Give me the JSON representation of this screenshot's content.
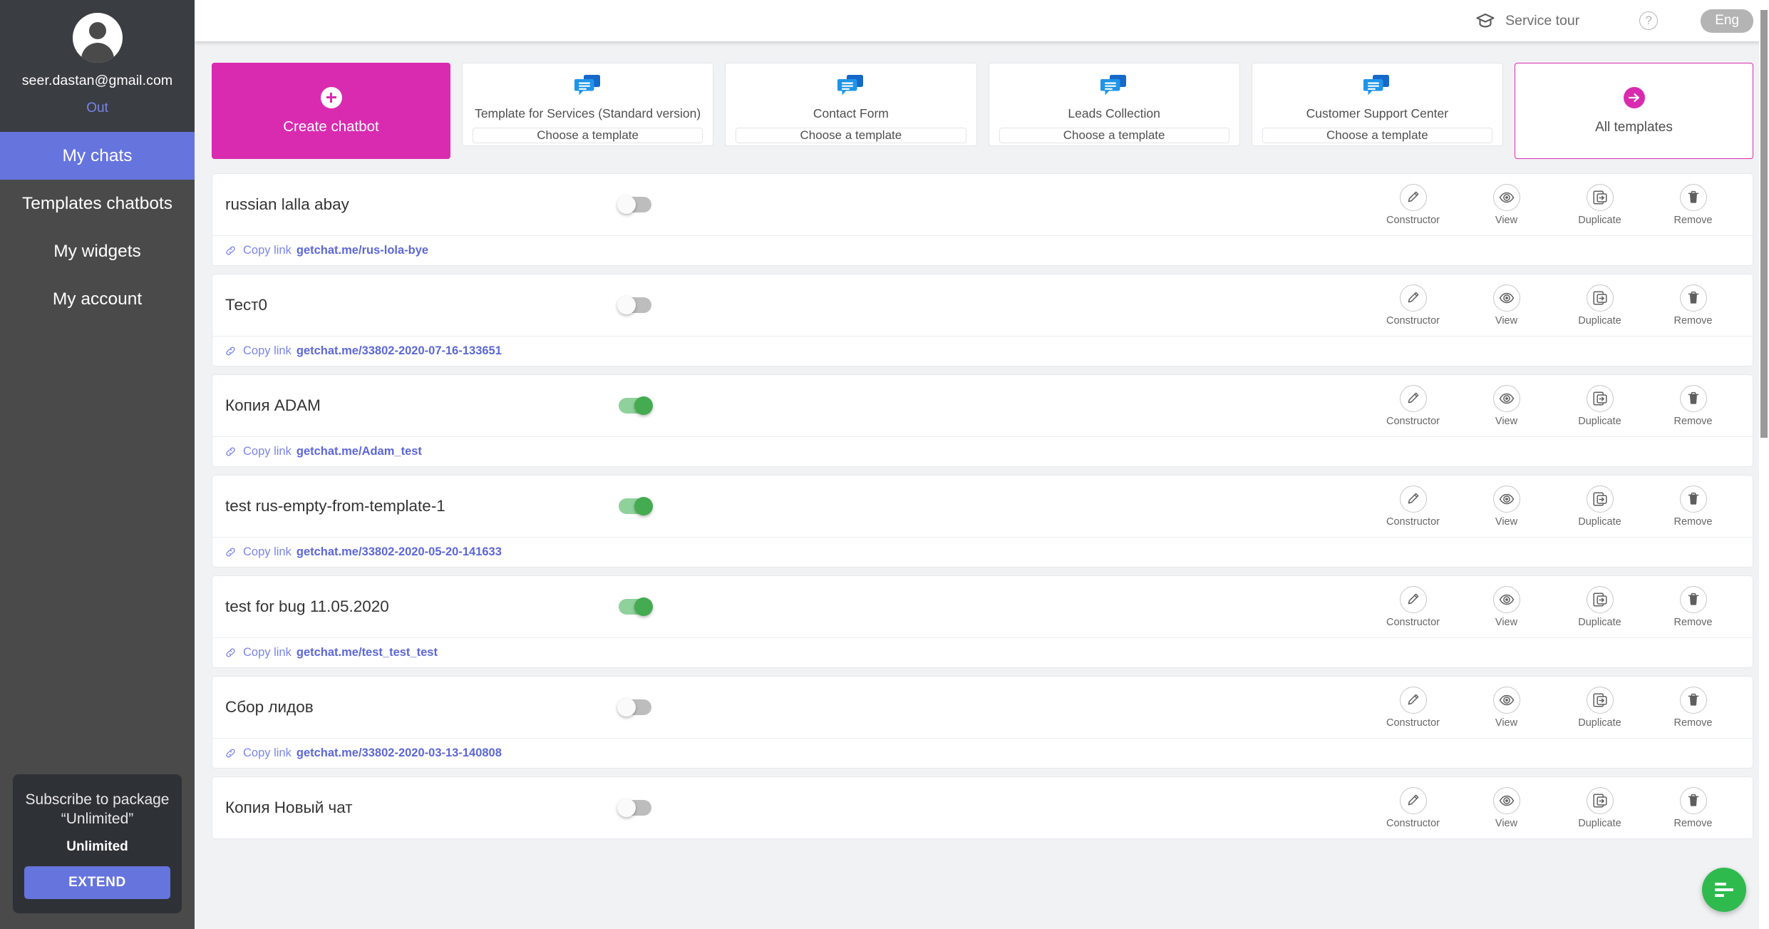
{
  "sidebar": {
    "avatar_icon": "user-avatar-icon",
    "email": "seer.dastan@gmail.com",
    "logout_label": "Out",
    "nav": [
      {
        "label": "My chats",
        "active": true
      },
      {
        "label": "Templates chatbots",
        "active": false
      },
      {
        "label": "My widgets",
        "active": false
      },
      {
        "label": "My account",
        "active": false
      }
    ],
    "subscribe": {
      "title": "Subscribe to package “Unlimited”",
      "plan": "Unlimited",
      "button_label": "EXTEND"
    }
  },
  "header": {
    "service_tour_label": "Service tour",
    "service_tour_icon": "graduation-cap-icon",
    "help_icon": "question-mark-icon",
    "help_glyph": "?",
    "language_label": "Eng"
  },
  "templates": {
    "create": {
      "label": "Create chatbot",
      "icon": "plus-circle-icon"
    },
    "cards": [
      {
        "name": "Template for Services (Standard version)",
        "button_label": "Choose a template",
        "icon": "chat-bubbles-icon"
      },
      {
        "name": "Contact Form",
        "button_label": "Choose a template",
        "icon": "chat-bubbles-icon"
      },
      {
        "name": "Leads Collection",
        "button_label": "Choose a template",
        "icon": "chat-bubbles-icon"
      },
      {
        "name": "Customer Support Center",
        "button_label": "Choose a template",
        "icon": "chat-bubbles-icon"
      }
    ],
    "all": {
      "label": "All templates",
      "icon": "arrow-right-circle-icon"
    }
  },
  "actions": {
    "constructor": {
      "label": "Constructor",
      "icon": "pencil-icon"
    },
    "view": {
      "label": "View",
      "icon": "eye-icon"
    },
    "duplicate": {
      "label": "Duplicate",
      "icon": "duplicate-icon"
    },
    "remove": {
      "label": "Remove",
      "icon": "trash-icon"
    }
  },
  "copy_link_label": "Copy link",
  "link_icon": "chain-link-icon",
  "chatbots": [
    {
      "name": "russian lalla abay",
      "enabled": false,
      "url": "getchat.me/rus-lola-bye"
    },
    {
      "name": "Тест0",
      "enabled": false,
      "url": "getchat.me/33802-2020-07-16-133651"
    },
    {
      "name": "Копия ADAM",
      "enabled": true,
      "url": "getchat.me/Adam_test"
    },
    {
      "name": "test rus-empty-from-template-1",
      "enabled": true,
      "url": "getchat.me/33802-2020-05-20-141633"
    },
    {
      "name": "test for bug 11.05.2020",
      "enabled": true,
      "url": "getchat.me/test_test_test"
    },
    {
      "name": "Сбор лидов",
      "enabled": false,
      "url": "getchat.me/33802-2020-03-13-140808"
    },
    {
      "name": "Копия Новый чат",
      "enabled": false,
      "url": ""
    }
  ],
  "fab": {
    "icon": "chat-lines-icon"
  },
  "colors": {
    "accent_magenta": "#d92bb0",
    "accent_purple": "#6674de",
    "link_purple": "#5c67d8",
    "toggle_on_green": "#44ab51",
    "fab_green": "#2fba4e",
    "bubble_blue_front": "#1f95e8",
    "bubble_blue_back": "#1668c9",
    "sidebar_bg": "#4a4a4a",
    "sidebar_profile_bg": "#3a3d42"
  }
}
